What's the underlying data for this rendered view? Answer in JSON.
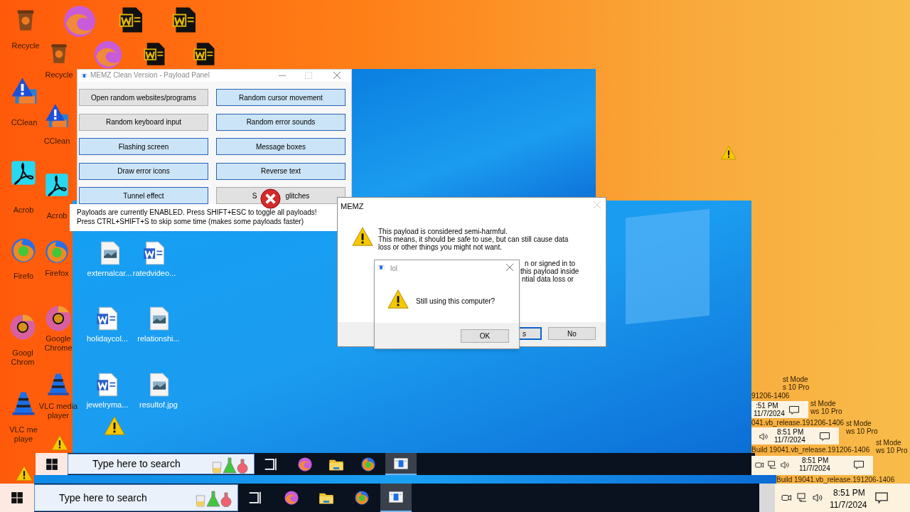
{
  "desktop_icons": [
    {
      "kind": "recycle",
      "label_lines": [
        "Recycle"
      ]
    },
    {
      "kind": "ccleaner",
      "label_lines": [
        "CClean"
      ]
    },
    {
      "kind": "acrobat",
      "label_lines": [
        "Acrob"
      ]
    },
    {
      "kind": "firefox",
      "label_lines": [
        "Firefo"
      ]
    },
    {
      "kind": "chrome",
      "label_lines": [
        "Googl",
        "Chrom"
      ]
    },
    {
      "kind": "vlc",
      "label_lines": [
        "VLC me",
        "playe"
      ]
    },
    {
      "kind": "recycle",
      "label_lines": [
        "Recycle"
      ]
    },
    {
      "kind": "ccleaner",
      "label_lines": [
        "CClean"
      ]
    },
    {
      "kind": "acrobat",
      "label_lines": [
        "Acrob"
      ]
    },
    {
      "kind": "firefox",
      "label_lines": [
        "Firefox"
      ]
    },
    {
      "kind": "chrome",
      "label_lines": [
        "Google",
        "Chrome"
      ]
    },
    {
      "kind": "vlc",
      "label_lines": [
        "VLC media",
        "player"
      ]
    },
    {
      "kind": "edge"
    },
    {
      "kind": "word_dark"
    },
    {
      "kind": "word_dark"
    },
    {
      "kind": "edge"
    },
    {
      "kind": "word_dark"
    },
    {
      "kind": "word_dark"
    },
    {
      "kind": "image",
      "label_lines": [
        "externalcar..."
      ]
    },
    {
      "kind": "word",
      "label_lines": [
        "ratedvideo..."
      ]
    },
    {
      "kind": "word",
      "label_lines": [
        "holidaycol..."
      ]
    },
    {
      "kind": "image",
      "label_lines": [
        "relationshi..."
      ]
    },
    {
      "kind": "word",
      "label_lines": [
        "jewelryma..."
      ]
    },
    {
      "kind": "image",
      "label_lines": [
        "resultof.jpg"
      ]
    },
    {
      "kind": "warning"
    },
    {
      "kind": "warning"
    },
    {
      "kind": "warning"
    },
    {
      "kind": "warning"
    }
  ],
  "payload_panel": {
    "title": "MEMZ Clean Version - Payload Panel",
    "buttons": [
      {
        "label_parts": [
          "Open random websites/programs"
        ],
        "on": false
      },
      {
        "label_parts": [
          "Random cursor movement"
        ],
        "on": true
      },
      {
        "label_parts": [
          "Random keyboard input"
        ],
        "on": false
      },
      {
        "label_parts": [
          "Random error sounds"
        ],
        "on": true
      },
      {
        "label_parts": [
          "Flashing screen"
        ],
        "on": true
      },
      {
        "label_parts": [
          "Message boxes"
        ],
        "on": true
      },
      {
        "label_parts": [
          "Draw error icons"
        ],
        "on": true
      },
      {
        "label_parts": [
          "Reverse text"
        ],
        "on": true
      },
      {
        "label_parts": [
          "Tunnel effect"
        ],
        "on": true
      },
      {
        "label_parts": [
          "S",
          "glitches"
        ],
        "on": false
      }
    ],
    "status_lines": [
      "Payloads are currently ENABLED. Press SHIFT+ESC to toggle all payloads!",
      "Press CTRL+SHIFT+S to skip some time (makes some payloads faster)"
    ]
  },
  "memz_dialog": {
    "title": "MEMZ",
    "message_lines": [
      "This payload is considered semi-harmful.",
      "This means, it should be safe to use, but can still cause data",
      "loss or other things you might not want."
    ],
    "partial_lines": [
      "n or signed in to",
      "this payload inside",
      "ntial data loss or"
    ],
    "buttons": [
      {
        "label": "s",
        "selected": true
      },
      {
        "label": "No",
        "selected": false
      }
    ]
  },
  "lol_dialog": {
    "title": "lol",
    "message": "Still using this computer?",
    "buttons": [
      "OK"
    ]
  },
  "taskbars": [
    {
      "search_placeholder": "Type here to search",
      "apps": [
        {
          "kind": "taskview",
          "selected": false
        },
        {
          "kind": "edge",
          "selected": false
        },
        {
          "kind": "folder",
          "selected": false
        },
        {
          "kind": "firefox",
          "selected": false
        },
        {
          "kind": "app",
          "selected": true
        }
      ]
    },
    {
      "search_placeholder": "Type here to search",
      "apps": [
        {
          "kind": "taskview",
          "selected": false
        },
        {
          "kind": "edge",
          "selected": false
        },
        {
          "kind": "folder",
          "selected": false
        },
        {
          "kind": "firefox",
          "selected": false
        },
        {
          "kind": "app",
          "selected": true
        }
      ],
      "tray": {
        "time": "8:51 PM",
        "date": "11/7/2024"
      }
    }
  ],
  "tray_copies": [
    {
      "time": "8:51 PM",
      "date": "11/7/2024"
    },
    {
      "time": "8:51 PM",
      "date": "11/7/2024"
    },
    {
      "time": ":51 PM",
      "date": "11/7/2024"
    }
  ],
  "test_mode_texts": [
    {
      "lines": [
        "st Mode",
        "s 10 Pro"
      ],
      "build": "91206-1406"
    },
    {
      "lines": [
        "st Mode",
        "ws 10 Pro"
      ],
      "build": "041.vb_release.191206-1406"
    },
    {
      "lines": [
        "st Mode",
        "ws 10 Pro"
      ],
      "build": "Build 19041.vb_release.191206-1406"
    },
    {
      "lines": [
        "st Mode",
        "ws 10 Pro"
      ],
      "build": "Build 19041.vb_release.191206-1406"
    }
  ]
}
